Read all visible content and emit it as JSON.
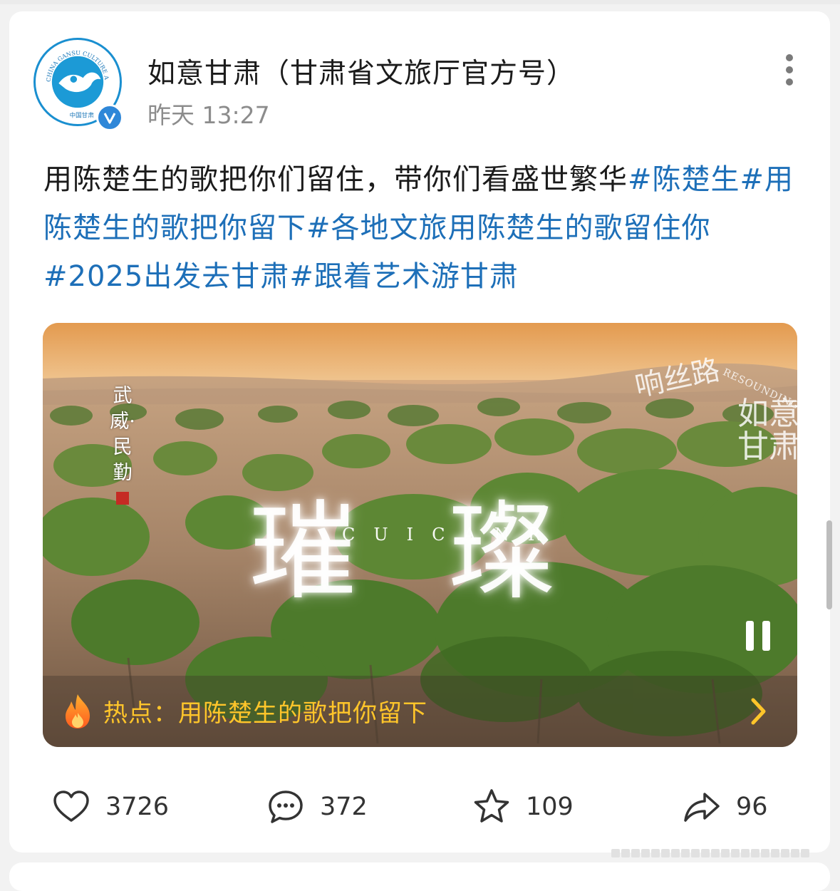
{
  "post": {
    "author": "如意甘肃（甘肃省文旅厅官方号）",
    "time": "昨天 13:27",
    "avatar_text": "CHINA GANSU CULTURE AND TOURISM",
    "avatar_sub": "中国甘肃",
    "verified_icon": "verified-v-icon",
    "text_plain": "用陈楚生的歌把你们留住，带你们看盛世繁华",
    "hashtags": [
      "#陈楚生",
      "#用陈楚生的歌把你留下",
      "#各地文旅用陈楚生的歌留住你",
      "#2025出发去甘肃",
      "#跟着艺术游甘肃"
    ],
    "more_icon": "more-vertical-icon"
  },
  "video": {
    "location": "武威·民勤",
    "title": "璀璨",
    "subtitle": "CUICANR",
    "watermark_line1": "响丝路",
    "watermark_line2": "RESOUNDING",
    "watermark_line3": "如意甘肃",
    "pause_icon": "pause-icon",
    "hot_label": "热点：用陈楚生的歌把你留下",
    "fire_icon": "fire-icon",
    "arrow_icon": "chevron-right-icon"
  },
  "actions": [
    {
      "icon": "heart-icon",
      "count": "3726"
    },
    {
      "icon": "comment-icon",
      "count": "372"
    },
    {
      "icon": "star-icon",
      "count": "109"
    },
    {
      "icon": "share-icon",
      "count": "96"
    }
  ],
  "colors": {
    "hashtag": "#1d6fb8",
    "hot_text": "#ffc52a",
    "verified": "#2f87d8"
  }
}
